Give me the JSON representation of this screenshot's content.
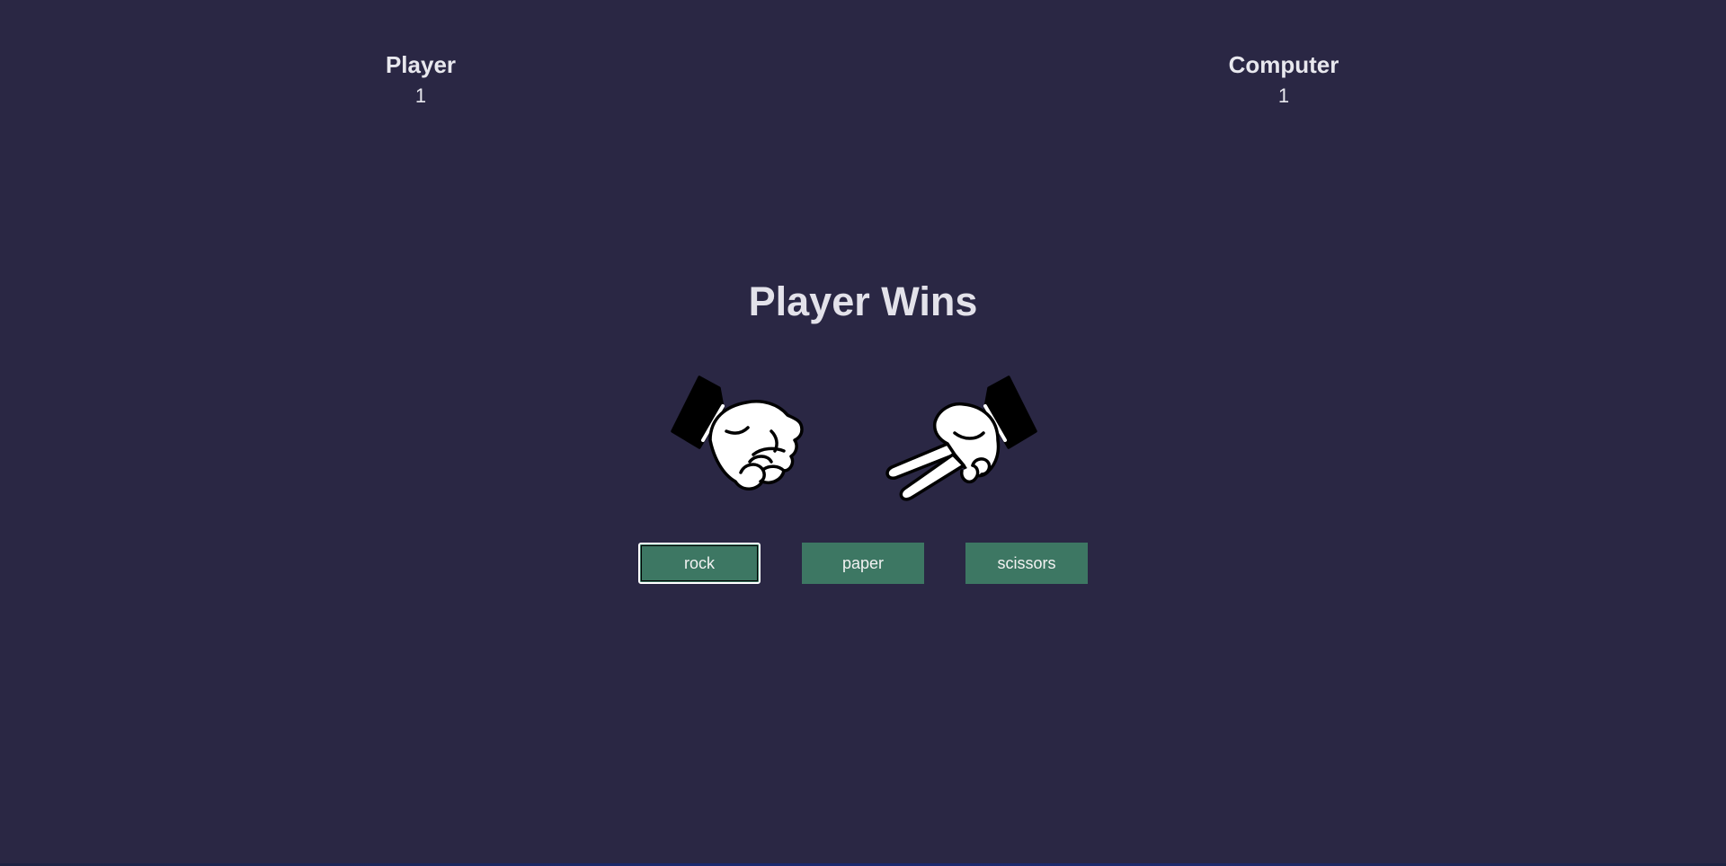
{
  "scoreboard": {
    "player_label": "Player",
    "player_score": "1",
    "computer_label": "Computer",
    "computer_score": "1"
  },
  "result": {
    "message": "Player Wins"
  },
  "hands": {
    "player_choice": "rock",
    "computer_choice": "scissors",
    "player_icon": "fist-hand-icon",
    "computer_icon": "scissors-hand-icon"
  },
  "choices": [
    {
      "label": "rock"
    },
    {
      "label": "paper"
    },
    {
      "label": "scissors"
    }
  ],
  "colors": {
    "background": "#2a2744",
    "button": "#3d7763",
    "text": "#e6e6ee"
  }
}
